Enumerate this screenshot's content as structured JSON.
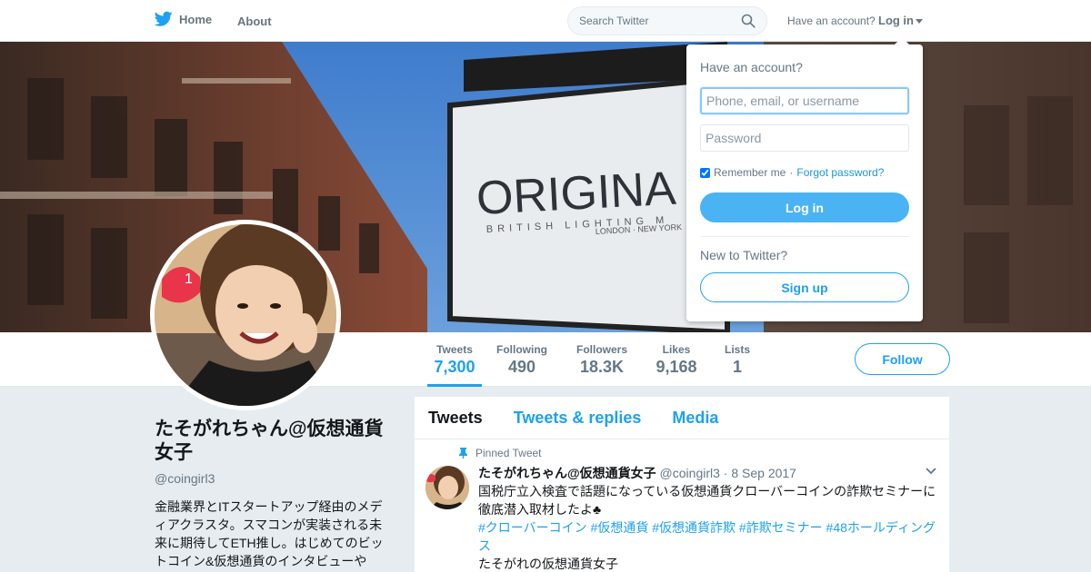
{
  "nav": {
    "home_label": "Home",
    "about_label": "About",
    "search_placeholder": "Search Twitter",
    "have_account": "Have an account?",
    "login_label": "Log in"
  },
  "stats": [
    {
      "label": "Tweets",
      "value": "7,300"
    },
    {
      "label": "Following",
      "value": "490"
    },
    {
      "label": "Followers",
      "value": "18.3K"
    },
    {
      "label": "Likes",
      "value": "9,168"
    },
    {
      "label": "Lists",
      "value": "1"
    }
  ],
  "follow_label": "Follow",
  "profile": {
    "name": "たそがれちゃん@仮想通貨女子",
    "handle": "@coingirl3",
    "bio": "金融業界とITスタートアップ経由のメディアクラスタ。スマコンが実装される未来に期待してETH推し。はじめてのビットコイン&仮想通貨のインタビューや"
  },
  "banner": {
    "sign_text": "ORIGINA",
    "sign_subtext": "BRITISH LIGHTING M",
    "sign_location": "LONDON · NEW YORK",
    "notification_count": "1"
  },
  "timeline": {
    "tabs": [
      "Tweets",
      "Tweets & replies",
      "Media"
    ],
    "pinned_label": "Pinned Tweet",
    "tweet": {
      "fullname": "たそがれちゃん@仮想通貨女子",
      "username": "@coingirl3",
      "date": "· 8 Sep 2017",
      "text": "国税庁立入検査で話題になっている仮想通貨クローバーコインの詐欺セミナーに徹底潜入取材したよ♣",
      "hashtags": "#クローバーコイン #仮想通貨 #仮想通貨詐欺 #詐欺セミナー #48ホールディングス",
      "footer": "たそがれの仮想通貨女子"
    }
  },
  "login_dropdown": {
    "title": "Have an account?",
    "username_placeholder": "Phone, email, or username",
    "password_placeholder": "Password",
    "remember_label": "Remember me",
    "separator": " · ",
    "forgot_label": "Forgot password?",
    "login_button": "Log in",
    "new_label": "New to Twitter?",
    "signup_button": "Sign up"
  },
  "colors": {
    "accent": "#1da1f2",
    "login_button": "#4ab3f4",
    "background": "#e6ecf0"
  }
}
